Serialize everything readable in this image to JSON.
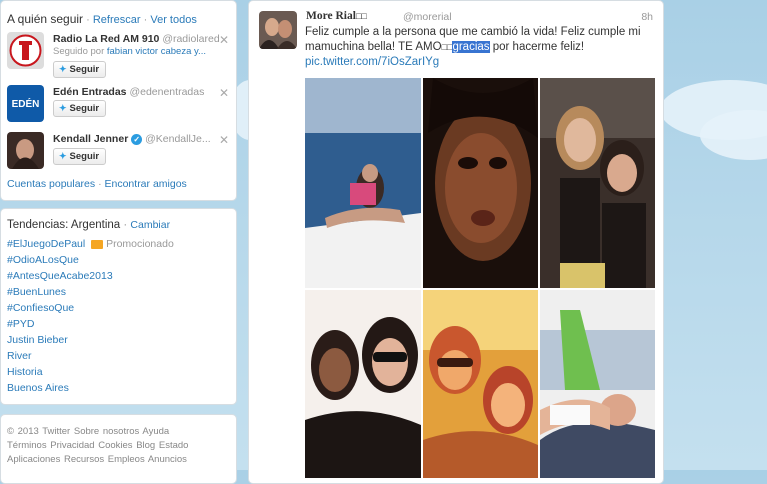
{
  "who_to_follow": {
    "title": "A quién seguir",
    "refresh": "Refrescar",
    "view_all": "Ver todos",
    "users": [
      {
        "name": "Radio La Red AM 910",
        "handle": "@radiolared",
        "followed_by_prefix": "Seguido por",
        "followed_by_names": "fabian victor cabeza y...",
        "button": "Seguir"
      },
      {
        "name": "Edén Entradas",
        "handle": "@edenentradas",
        "button": "Seguir",
        "logo_text": "EDÉN"
      },
      {
        "name": "Kendall Jenner",
        "handle": "@KendallJe...",
        "button": "Seguir"
      }
    ],
    "popular_accounts": "Cuentas populares",
    "separator": "·",
    "find_friends": "Encontrar amigos"
  },
  "trends": {
    "title": "Tendencias: Argentina",
    "separator": "·",
    "change": "Cambiar",
    "items": [
      "#ElJuegoDePaul",
      "#OdioALosQue",
      "#AntesQueAcabe2013",
      "#BuenLunes",
      "#ConfiesoQue",
      "#PYD",
      "Justin Bieber",
      "River",
      "Historia",
      "Buenos Aires"
    ],
    "promoted_label": "Promocionado"
  },
  "footer": {
    "line1": [
      "© 2013 Twitter",
      "Sobre nosotros",
      "Ayuda"
    ],
    "line2": [
      "Términos",
      "Privacidad",
      "Cookies",
      "Blog",
      "Estado"
    ],
    "line3": [
      "Aplicaciones",
      "Recursos",
      "Empleos",
      "Anuncios"
    ]
  },
  "tweet": {
    "name": "More Rial",
    "name_glyphs": "□□",
    "handle": "@morerial",
    "time": "8h",
    "text_part1": "Feliz cumple a la persona que me cambió la vida! Feliz cumple mi mamuchina bella! TE AMO",
    "text_glyphs": "□□",
    "text_highlight": "gracias",
    "text_part2": " por hacerme feliz!",
    "link": "pic.twitter.com/7iOsZarIYg"
  },
  "colors": {
    "link": "#2b7bb9",
    "highlight": "#3874d1",
    "promoted": "#f5a623"
  },
  "icons": [
    "close-icon",
    "bird-icon",
    "verified-icon",
    "promoted-icon"
  ]
}
